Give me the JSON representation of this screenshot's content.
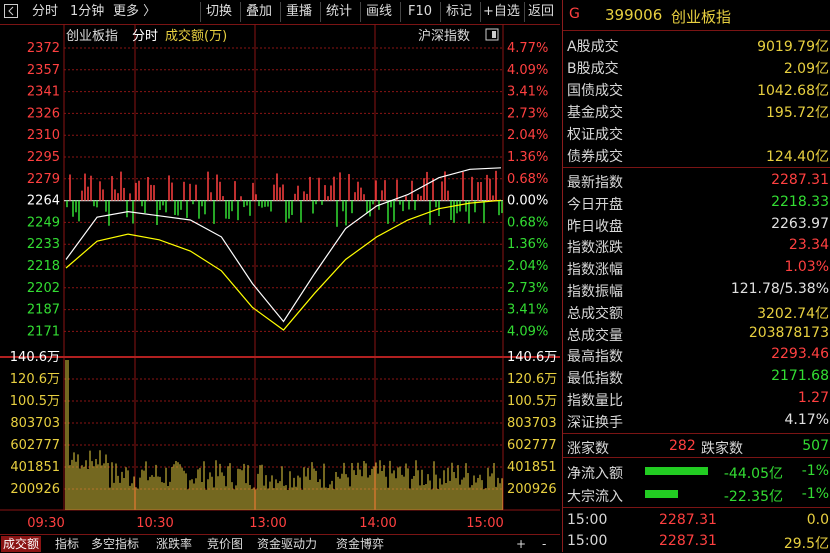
{
  "toolbar": {
    "back_icon": "back-square-icon",
    "items": [
      "分时",
      "1分钟",
      "更多 〉",
      "切换",
      "叠加",
      "重播",
      "统计",
      "画线",
      "F10",
      "标记",
      "+自选",
      "返回"
    ],
    "active_index": 0
  },
  "chart_header": {
    "index_name": "创业板指",
    "mode": "分时",
    "metric": "成交额(万)",
    "compare_label": "沪深指数"
  },
  "price_axis": {
    "left": [
      "2372",
      "2357",
      "2341",
      "2326",
      "2310",
      "2295",
      "2279",
      "2264",
      "2249",
      "2233",
      "2218",
      "2202",
      "2187",
      "2171"
    ],
    "right": [
      "4.77%",
      "4.09%",
      "3.41%",
      "2.73%",
      "2.04%",
      "1.36%",
      "0.68%",
      "0.00%",
      "0.68%",
      "1.36%",
      "2.04%",
      "2.73%",
      "3.41%",
      "4.09%"
    ]
  },
  "volume_axis": {
    "labels": [
      "140.6万",
      "120.6万",
      "100.5万",
      "803703",
      "602777",
      "401851",
      "200926"
    ]
  },
  "time_axis": [
    "09:30",
    "10:30",
    "13:00",
    "14:00",
    "15:00"
  ],
  "chart_data": {
    "type": "line",
    "title": "创业板指",
    "x": [
      "09:30",
      "10:30",
      "13:00",
      "14:00",
      "15:00"
    ],
    "ylim": [
      2171,
      2372
    ],
    "prev_close": 2263.97,
    "series": [
      {
        "name": "创业板指",
        "color": "#ffffff",
        "values": [
          2222,
          2252,
          2256,
          2253,
          2250,
          2238,
          2205,
          2178,
          2212,
          2244,
          2260,
          2268,
          2280,
          2286,
          2287
        ]
      },
      {
        "name": "均价",
        "color": "#ffff00",
        "values": [
          2216,
          2235,
          2240,
          2236,
          2228,
          2214,
          2188,
          2172,
          2198,
          2222,
          2238,
          2250,
          2258,
          2262,
          2264
        ]
      }
    ],
    "volume_max": 1406000
  },
  "right_panel": {
    "code": "399006",
    "name": "创业板指",
    "g_mark": "G",
    "rows_top": [
      {
        "label": "A股成交",
        "value": "9019.79亿",
        "color": "#e8d040"
      },
      {
        "label": "B股成交",
        "value": "2.09亿",
        "color": "#e8d040"
      },
      {
        "label": "国债成交",
        "value": "1042.68亿",
        "color": "#e8d040"
      },
      {
        "label": "基金成交",
        "value": "195.72亿",
        "color": "#e8d040"
      },
      {
        "label": "权证成交",
        "value": "",
        "color": "#e8d040"
      },
      {
        "label": "债券成交",
        "value": "124.40亿",
        "color": "#e8d040"
      }
    ],
    "rows_mid": [
      {
        "label": "最新指数",
        "value": "2287.31",
        "color": "#ff4040"
      },
      {
        "label": "今日开盘",
        "value": "2218.33",
        "color": "#33dd33"
      },
      {
        "label": "昨日收盘",
        "value": "2263.97",
        "color": "#e0e0e0"
      },
      {
        "label": "指数涨跌",
        "value": "23.34",
        "color": "#ff4040"
      },
      {
        "label": "指数涨幅",
        "value": "1.03%",
        "color": "#ff4040"
      },
      {
        "label": "指数振幅",
        "value": "121.78/5.38%",
        "color": "#e0e0e0"
      },
      {
        "label": "总成交额",
        "value": "3202.74亿",
        "color": "#e8d040"
      },
      {
        "label": "总成交量",
        "value": "203878173",
        "color": "#e8d040"
      },
      {
        "label": "最高指数",
        "value": "2293.46",
        "color": "#ff4040"
      },
      {
        "label": "最低指数",
        "value": "2171.68",
        "color": "#33dd33"
      },
      {
        "label": "指数量比",
        "value": "1.27",
        "color": "#ff4040"
      },
      {
        "label": "深证换手",
        "value": "4.17%",
        "color": "#e0e0e0"
      }
    ],
    "breadth": {
      "up_label": "涨家数",
      "up_value": "282",
      "down_label": "跌家数",
      "down_value": "507"
    },
    "flows": [
      {
        "label": "净流入额",
        "value": "-44.05亿",
        "pct": "-1%",
        "bar_fraction": 0.42
      },
      {
        "label": "大宗流入",
        "value": "-22.35亿",
        "pct": "-1%",
        "bar_fraction": 0.22
      }
    ],
    "ticks": [
      {
        "time": "15:00",
        "price": "2287.31",
        "vol": "0.0"
      },
      {
        "time": "15:00",
        "price": "2287.31",
        "vol": "29.5亿"
      }
    ]
  },
  "bottom_tabs": {
    "items": [
      "成交额",
      "指标",
      "多空指标",
      "涨跌率",
      "竞价图",
      "资金驱动力",
      "资金博弈"
    ],
    "active_index": 0,
    "plus": "+",
    "minus": "-"
  },
  "colors": {
    "up": "#ff4040",
    "down": "#33dd33",
    "grid": "#8a1414",
    "avg": "#ffff00"
  }
}
